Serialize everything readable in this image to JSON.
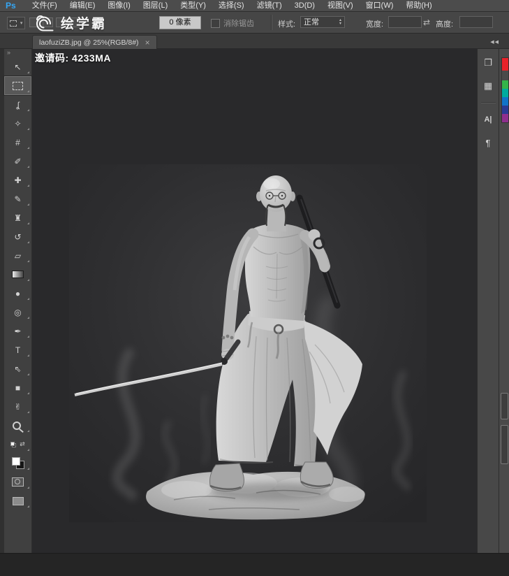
{
  "app": {
    "logo": "Ps",
    "menu": [
      "文件(F)",
      "编辑(E)",
      "图像(I)",
      "图层(L)",
      "类型(Y)",
      "选择(S)",
      "滤镜(T)",
      "3D(D)",
      "视图(V)",
      "窗口(W)",
      "帮助(H)"
    ]
  },
  "options": {
    "brand": "绘学霸",
    "feather_value": "0 像素",
    "anti_alias_label": "消除锯齿",
    "style_label": "样式:",
    "style_value": "正常",
    "width_label": "宽度:",
    "width_value": "",
    "height_label": "高度:",
    "height_value": "",
    "swap_glyph": "⇄",
    "preset_caret": "▾",
    "spin_up": "▴",
    "spin_down": "▾"
  },
  "tab": {
    "title": "laofuziZB.jpg @ 25%(RGB/8#)",
    "close_glyph": "×"
  },
  "overlay": {
    "invite_code": "邀请码: 4233MA"
  },
  "toolbar": {
    "collapse_glyph": "»",
    "tools": [
      {
        "name": "move",
        "glyph": "↖"
      },
      {
        "name": "rectangular-marquee",
        "glyph": ""
      },
      {
        "name": "lasso",
        "glyph": "ʆ"
      },
      {
        "name": "magic-wand",
        "glyph": "✧"
      },
      {
        "name": "crop",
        "glyph": "#"
      },
      {
        "name": "eyedropper",
        "glyph": "✐"
      },
      {
        "name": "healing-brush",
        "glyph": "✚"
      },
      {
        "name": "brush",
        "glyph": "✎"
      },
      {
        "name": "clone-stamp",
        "glyph": "♜"
      },
      {
        "name": "history-brush",
        "glyph": "↺"
      },
      {
        "name": "eraser",
        "glyph": "▱"
      },
      {
        "name": "gradient",
        "glyph": ""
      },
      {
        "name": "blur",
        "glyph": "●"
      },
      {
        "name": "dodge",
        "glyph": "◎"
      },
      {
        "name": "pen",
        "glyph": "✒"
      },
      {
        "name": "type",
        "glyph": "T"
      },
      {
        "name": "path-selection",
        "glyph": "⇖"
      },
      {
        "name": "rectangle",
        "glyph": "■"
      },
      {
        "name": "hand",
        "glyph": "✌"
      },
      {
        "name": "zoom",
        "glyph": ""
      },
      {
        "name": "color-controls",
        "glyph": "⇄"
      },
      {
        "name": "fg-bg-swatches",
        "glyph": ""
      },
      {
        "name": "quick-mask",
        "glyph": ""
      },
      {
        "name": "screen-mode",
        "glyph": ""
      }
    ]
  },
  "swatches": {
    "foreground": "#ffffff",
    "background": "#161616"
  },
  "dock": {
    "collapse_glyph": "◀◀",
    "icons": [
      {
        "name": "clone-source",
        "glyph": "❐"
      },
      {
        "name": "swatches",
        "glyph": "▦"
      },
      {
        "name": "character",
        "glyph": "A|"
      },
      {
        "name": "paragraph",
        "glyph": "¶"
      }
    ]
  },
  "colorbar": {
    "segments": [
      {
        "color": "#e8222a"
      },
      {
        "color": "#4a4a4a"
      },
      {
        "color": "#35b44a"
      },
      {
        "color": "#00ab9e"
      },
      {
        "color": "#1273c8"
      },
      {
        "color": "#2b3a94"
      },
      {
        "color": "#8e2f8e"
      }
    ]
  }
}
